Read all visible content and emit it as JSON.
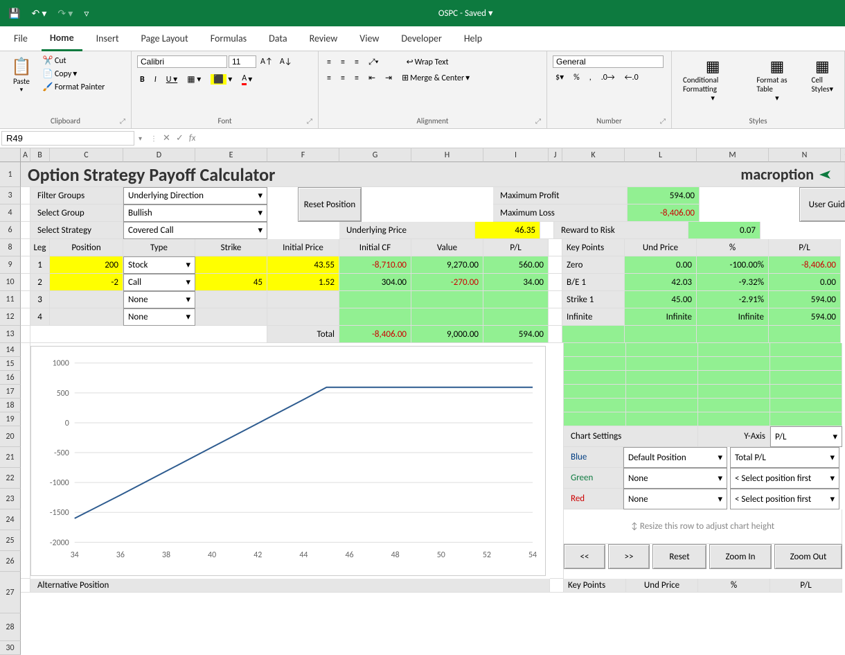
{
  "title": "OSPC - Saved",
  "menu": [
    "File",
    "Home",
    "Insert",
    "Page Layout",
    "Formulas",
    "Data",
    "Review",
    "View",
    "Developer",
    "Help"
  ],
  "ribbon": {
    "paste": "Paste",
    "cut": "Cut",
    "copy": "Copy",
    "format_painter": "Format Painter",
    "clipboard": "Clipboard",
    "font_name": "Calibri",
    "font_size": "11",
    "font_label": "Font",
    "wrap": "Wrap Text",
    "merge": "Merge & Center",
    "align_label": "Alignment",
    "number_format": "General",
    "number_label": "Number",
    "cond_fmt": "Conditional Formatting",
    "fmt_table": "Format as Table",
    "cell_styles": "Cell Styles",
    "styles_label": "Styles"
  },
  "namebox": "R49",
  "sheet": {
    "title": "Option Strategy Payoff Calculator",
    "brand": "macroption",
    "filter_groups": "Filter Groups",
    "filter_groups_val": "Underlying Direction",
    "select_group": "Select Group",
    "select_group_val": "Bullish",
    "select_strategy": "Select Strategy",
    "select_strategy_val": "Covered Call",
    "reset_btn": "Reset Position",
    "user_guide": "User Guide",
    "und_price_lbl": "Underlying Price",
    "und_price_val": "46.35",
    "max_profit_lbl": "Maximum Profit",
    "max_profit": "594.00",
    "max_loss_lbl": "Maximum Loss",
    "max_loss": "-8,406.00",
    "rr_lbl": "Reward to Risk",
    "rr": "0.07",
    "leg_hdrs": [
      "Leg",
      "Position",
      "Type",
      "Strike",
      "Initial Price",
      "Initial CF",
      "Value",
      "P/L"
    ],
    "legs": [
      {
        "n": "1",
        "pos": "200",
        "type": "Stock",
        "strike": "",
        "price": "43.55",
        "cf": "-8,710.00",
        "val": "9,270.00",
        "pl": "560.00"
      },
      {
        "n": "2",
        "pos": "-2",
        "type": "Call",
        "strike": "45",
        "price": "1.52",
        "cf": "304.00",
        "val": "-270.00",
        "pl": "34.00"
      },
      {
        "n": "3",
        "pos": "",
        "type": "None",
        "strike": "",
        "price": "",
        "cf": "",
        "val": "",
        "pl": ""
      },
      {
        "n": "4",
        "pos": "",
        "type": "None",
        "strike": "",
        "price": "",
        "cf": "",
        "val": "",
        "pl": ""
      }
    ],
    "total_lbl": "Total",
    "total_cf": "-8,406.00",
    "total_val": "9,000.00",
    "total_pl": "594.00",
    "kp_hdrs": [
      "Key Points",
      "Und Price",
      "%",
      "P/L"
    ],
    "kps": [
      {
        "name": "Zero",
        "up": "0.00",
        "pct": "-100.00%",
        "pl": "-8,406.00",
        "plred": true
      },
      {
        "name": "B/E 1",
        "up": "42.03",
        "pct": "-9.32%",
        "pl": "0.00"
      },
      {
        "name": "Strike 1",
        "up": "45.00",
        "pct": "-2.91%",
        "pl": "594.00"
      },
      {
        "name": "Infinite",
        "up": "Infinite",
        "pct": "Infinite",
        "pl": "594.00"
      }
    ],
    "chart_settings": "Chart Settings",
    "yaxis_lbl": "Y-Axis",
    "yaxis_val": "P/L",
    "blue": "Blue",
    "blue_a": "Default Position",
    "blue_b": "Total P/L",
    "green": "Green",
    "green_a": "None",
    "green_b": "< Select position first",
    "red": "Red",
    "red_a": "None",
    "red_b": "< Select position first",
    "resize_hint": "↕ Resize this row to adjust chart height",
    "nav": [
      "<<",
      ">>",
      "Reset",
      "Zoom In",
      "Zoom Out"
    ],
    "alt_pos": "Alternative Position",
    "kp2_hdrs": [
      "Key Points",
      "Und Price",
      "%",
      "P/L"
    ]
  },
  "chart_data": {
    "type": "line",
    "x": [
      34,
      36,
      38,
      40,
      42,
      44,
      45,
      46,
      48,
      50,
      52,
      54
    ],
    "y": [
      -1600,
      -1210,
      -810,
      -410,
      -10,
      390,
      594,
      594,
      594,
      594,
      594,
      594
    ],
    "xlim": [
      34,
      54
    ],
    "ylim": [
      -2000,
      1000
    ],
    "xticks": [
      34,
      36,
      38,
      40,
      42,
      44,
      46,
      48,
      50,
      52,
      54
    ],
    "yticks": [
      -2000,
      -1500,
      -1000,
      -500,
      0,
      500,
      1000
    ]
  }
}
